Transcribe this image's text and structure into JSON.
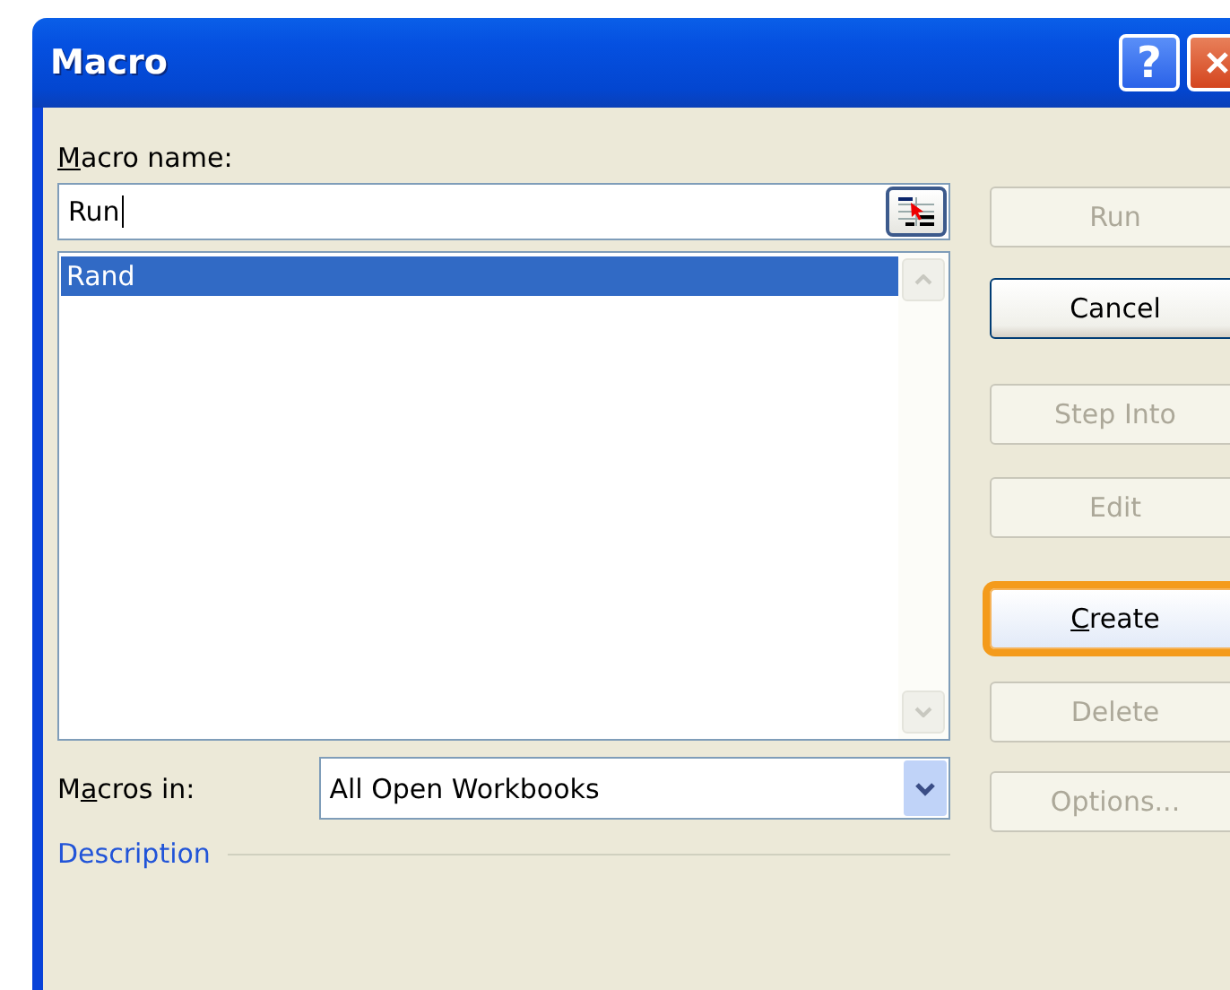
{
  "window": {
    "title": "Macro",
    "help": "?"
  },
  "macro_name": {
    "label": {
      "key": "M",
      "after": "acro name:"
    },
    "value": "Run"
  },
  "macros": [
    {
      "name": "Rand",
      "selected": true
    }
  ],
  "macros_in": {
    "label": {
      "before": "M",
      "key": "a",
      "after": "cros in:"
    },
    "value": "All Open Workbooks"
  },
  "description": {
    "label": "Description"
  },
  "buttons": [
    {
      "label": {
        "after": "Run"
      },
      "disabled": true,
      "focused": false
    },
    {
      "label": {
        "after": "Cancel"
      },
      "disabled": false,
      "focused": false
    },
    {
      "label": {
        "after": "Step Into"
      },
      "disabled": true,
      "focused": false
    },
    {
      "label": {
        "after": "Edit"
      },
      "disabled": true,
      "focused": false
    },
    {
      "label": {
        "key": "C",
        "after": "reate"
      },
      "disabled": false,
      "focused": true
    },
    {
      "label": {
        "after": "Delete"
      },
      "disabled": true,
      "focused": false
    },
    {
      "label": {
        "after": "Options..."
      },
      "disabled": true,
      "focused": false
    }
  ]
}
